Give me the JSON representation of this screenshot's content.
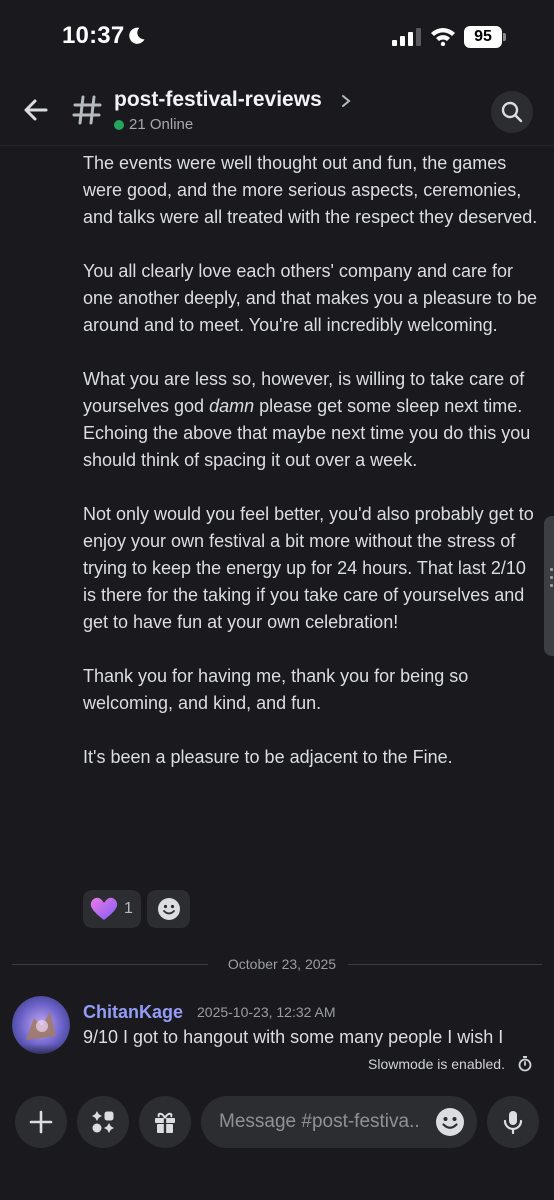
{
  "status_bar": {
    "time": "10:37",
    "battery": "95"
  },
  "header": {
    "channel_name": "post-festival-reviews",
    "online": "21 Online"
  },
  "message": {
    "paragraphs": [
      "The events were well thought out and fun, the games were good, and the more serious aspects, ceremonies, and talks were all treated with the respect they deserved.",
      "You all clearly love each others' company and care for one another deeply, and that makes you a pleasure to be around and to meet. You're all incredibly welcoming.",
      "Not only would you feel better, you'd also probably get to enjoy your own festival a bit more without the stress of trying to keep the energy up for 24 hours. That last 2/10 is there for the taking if you take care of yourselves and get to have fun at your own celebration!",
      "Thank you for having me, thank you for being so welcoming, and kind, and fun.",
      "It's been a pleasure to be adjacent to the Fine."
    ],
    "para3_before": "What you are less so, however, is willing to take care of yourselves god ",
    "para3_em": "damn",
    "para3_after": " please get some sleep next time. Echoing the above that maybe next time you do this you should think of spacing it out over a week.",
    "reactions": [
      {
        "icon": "purple-heart-icon",
        "count": "1"
      }
    ]
  },
  "divider": {
    "date": "October 23, 2025"
  },
  "message2": {
    "author": "ChitanKage",
    "timestamp": "2025-10-23, 12:32 AM",
    "text": "9/10 I got to hangout with some many people I wish I"
  },
  "slowmode": "Slowmode is enabled.",
  "composer": {
    "placeholder": "Message #post-festiva..",
    "buttons": [
      "plus-icon",
      "apps-icon",
      "gift-icon",
      "emoji-icon",
      "microphone-icon"
    ]
  },
  "colors": {
    "background": "#1a1a1e",
    "author": "#949cf7",
    "online": "#23a55a",
    "button_bg": "#2b2d31"
  }
}
